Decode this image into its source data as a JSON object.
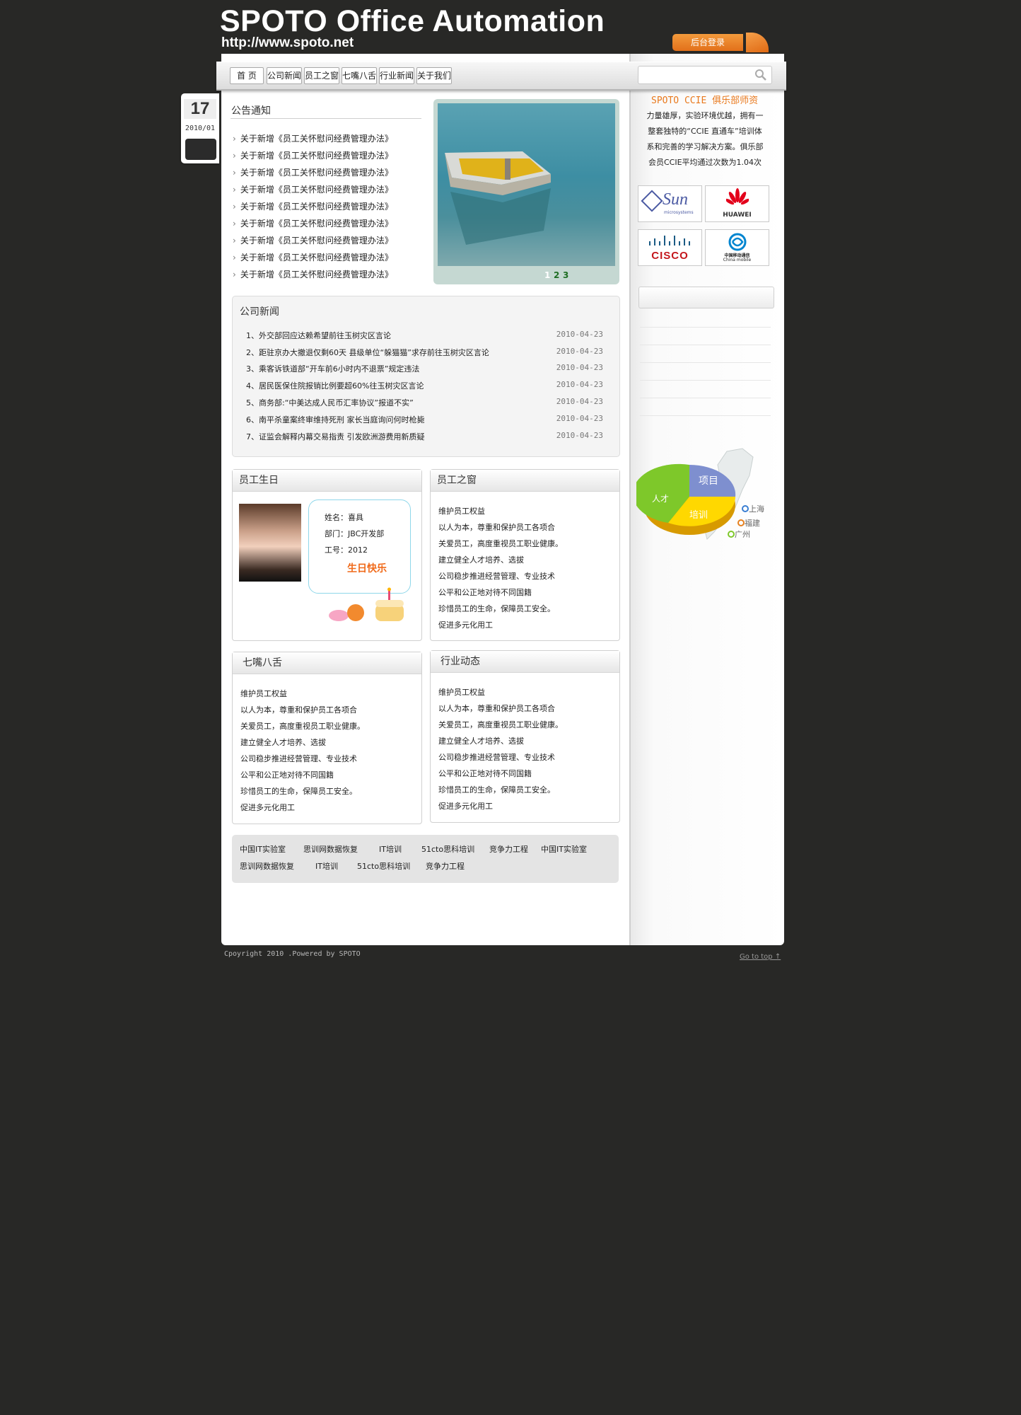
{
  "header": {
    "site_title": "SPOTO Office Automation",
    "site_url": "http://www.spoto.net",
    "login_label": "后台登录"
  },
  "nav": {
    "items": [
      "首 页",
      "公司新闻",
      "员工之窗",
      "七嘴八舌",
      "行业新闻",
      "关于我们"
    ],
    "search_placeholder": ""
  },
  "date_badge": {
    "day": "17",
    "year_month": "2010/01"
  },
  "notice": {
    "title": "公告通知",
    "items": [
      "关于新增《员工关怀慰问经费管理办法》",
      "关于新增《员工关怀慰问经费管理办法》",
      "关于新增《员工关怀慰问经费管理办法》",
      "关于新增《员工关怀慰问经费管理办法》",
      "关于新增《员工关怀慰问经费管理办法》",
      "关于新增《员工关怀慰问经费管理办法》",
      "关于新增《员工关怀慰问经费管理办法》",
      "关于新增《员工关怀慰问经费管理办法》",
      "关于新增《员工关怀慰问经费管理办法》"
    ]
  },
  "slideshow": {
    "pages": [
      "1",
      "2",
      "3"
    ],
    "active_page": 1
  },
  "company_news": {
    "title": "公司新闻",
    "items": [
      {
        "title": "1、外交部回应达赖希望前往玉树灾区言论",
        "date": "2010-04-23"
      },
      {
        "title": "2、距驻京办大撤退仅剩60天 县级单位“躲猫猫”求存前往玉树灾区言论",
        "date": "2010-04-23"
      },
      {
        "title": "3、乘客诉铁道部“开车前6小时内不退票”规定违法",
        "date": "2010-04-23"
      },
      {
        "title": "4、居民医保住院报销比例要超60%往玉树灾区言论",
        "date": "2010-04-23"
      },
      {
        "title": "5、商务部:“中美达成人民币汇率协议”报道不实”",
        "date": "2010-04-23"
      },
      {
        "title": "6、南平杀童案终审维持死刑 家长当庭询问何时枪毙",
        "date": "2010-04-23"
      },
      {
        "title": "7、证监会解释内幕交易指责 引发欧洲游费用新质疑",
        "date": "2010-04-23"
      }
    ]
  },
  "birthday": {
    "title": "员工生日",
    "name": "姓名：喜具",
    "dept": "部门：JBC开发部",
    "id": "工号：2012",
    "wish": "生日快乐"
  },
  "staff_window": {
    "title": "员工之窗",
    "items": [
      "维护员工权益",
      "以人为本，尊重和保护员工各项合",
      "关爱员工，高度重视员工职业健康。",
      "建立健全人才培养、选拔",
      "公司稳步推进经营管理、专业技术",
      "公平和公正地对待不同国籍",
      "珍惜员工的生命，保障员工安全。",
      "促进多元化用工"
    ]
  },
  "chatter": {
    "title": "七嘴八舌",
    "items": [
      "维护员工权益",
      "以人为本，尊重和保护员工各项合",
      "关爱员工，高度重视员工职业健康。",
      "建立健全人才培养、选拔",
      "公司稳步推进经营管理、专业技术",
      "公平和公正地对待不同国籍",
      "珍惜员工的生命，保障员工安全。",
      "促进多元化用工"
    ]
  },
  "industry": {
    "title": "行业动态",
    "items": [
      "维护员工权益",
      "以人为本，尊重和保护员工各项合",
      "关爱员工，高度重视员工职业健康。",
      "建立健全人才培养、选拔",
      "公司稳步推进经营管理、专业技术",
      "公平和公正地对待不同国籍",
      "珍惜员工的生命，保障员工安全。",
      "促进多元化用工"
    ]
  },
  "links": {
    "row1": [
      "中国IT实验室",
      "思训网数据恢复",
      "IT培训",
      "51cto思科培训",
      "竞争力工程",
      "中国IT实验室"
    ],
    "row2": [
      "思训网数据恢复",
      "IT培训",
      "51cto思科培训",
      "竞争力工程"
    ]
  },
  "sidebar": {
    "title": "SPOTO CCIE 俱乐部师资",
    "lines": [
      "力量雄厚，实验环境优越，拥有一",
      "整套独特的“CCIE 直通车”培训体",
      "系和完善的学习解决方案。俱乐部",
      "会员CCIE平均通过次数为1.04次"
    ],
    "logos": [
      "Sun",
      "HUAWEI",
      "CISCO",
      "中国移动通信"
    ],
    "logo_sub": [
      "microsystems",
      "China mobile"
    ],
    "pie_labels": [
      "项目",
      "人才",
      "培训"
    ],
    "cities": [
      "上海",
      "福建",
      "广州"
    ]
  },
  "footer": {
    "copyright": "Cpoyright 2010 .Powered by SPOTO",
    "go_top": "Go to top ↑"
  },
  "colors": {
    "accent": "#e9791d",
    "background": "#282826",
    "pie_project": "#7e8fcf",
    "pie_talent": "#7ec82a",
    "pie_training": "#ffd800"
  }
}
